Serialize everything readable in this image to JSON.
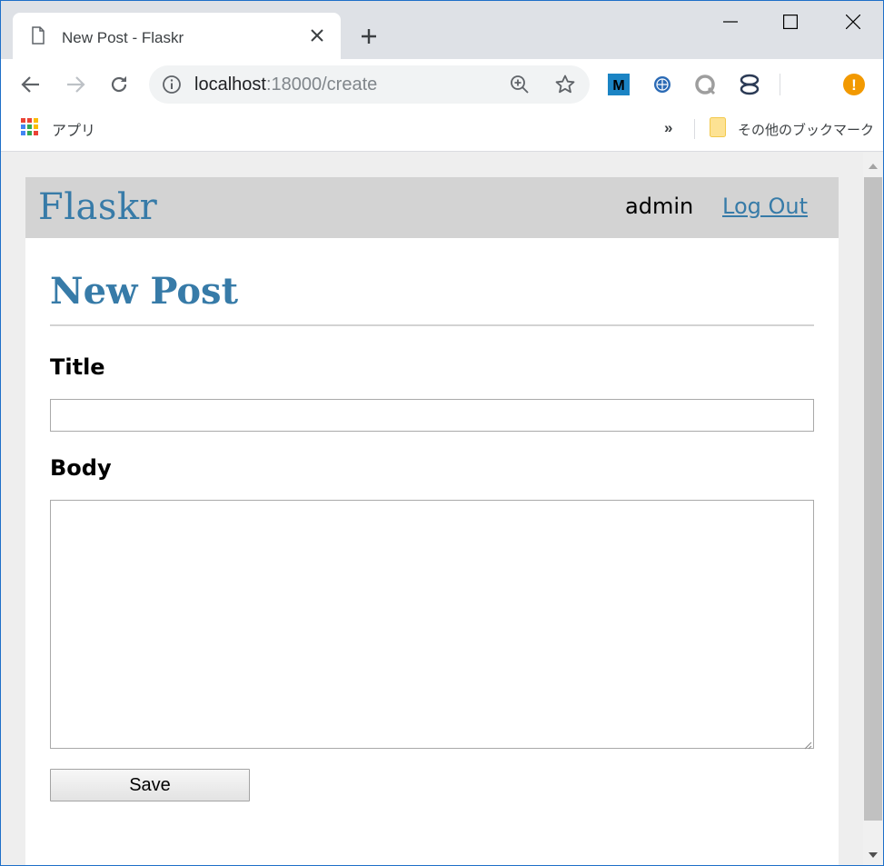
{
  "browser": {
    "tab": {
      "title": "New Post - Flaskr"
    },
    "address_bar": {
      "host": "localhost",
      "path": ":18000/create"
    },
    "bookmarks": {
      "apps_label": "アプリ",
      "overflow_label": "»",
      "other_label": "その他のブックマーク"
    },
    "extensions": [
      {
        "name": "m-extension-icon",
        "glyph": "M"
      },
      {
        "name": "globe-extension-icon"
      },
      {
        "name": "q-extension-icon"
      },
      {
        "name": "hourglass-extension-icon"
      },
      {
        "name": "update-alert-icon",
        "glyph": "!"
      }
    ],
    "accent_color": "#1e6fc8",
    "alert_color": "#f29900"
  },
  "site": {
    "brand": "Flaskr",
    "user": "admin",
    "logout_label": "Log Out",
    "link_color": "#377ba8",
    "nav_background": "#d3d3d3"
  },
  "form": {
    "heading": "New Post",
    "title_label": "Title",
    "title_value": "",
    "body_label": "Body",
    "body_value": "",
    "save_label": "Save"
  }
}
